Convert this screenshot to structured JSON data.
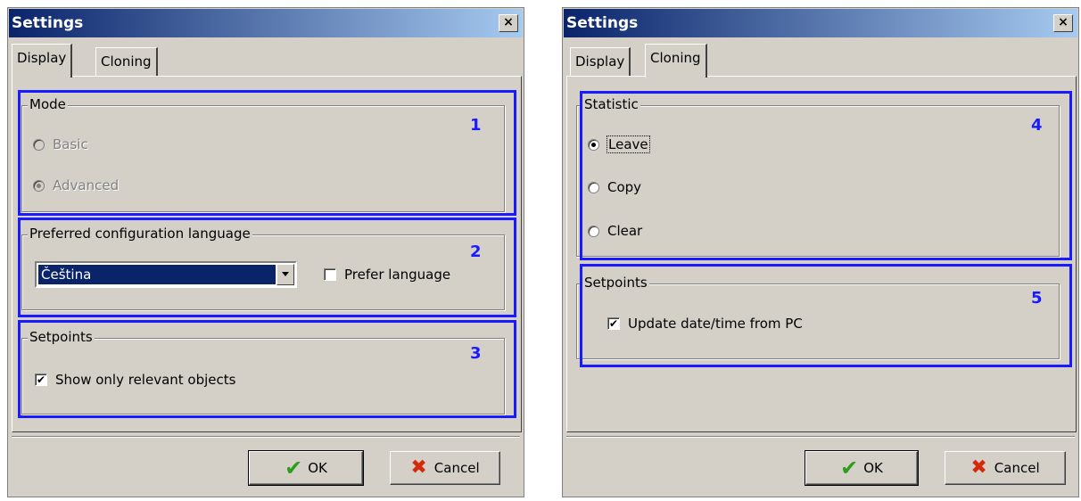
{
  "left_dialog": {
    "title": "Settings",
    "close": "×",
    "tabs": [
      "Display",
      "Cloning"
    ],
    "active_tab": "Display",
    "mode": {
      "title": "Mode",
      "options": [
        "Basic",
        "Advanced"
      ],
      "selected": "Advanced",
      "enabled": false,
      "marker": "1"
    },
    "language": {
      "title": "Preferred configuration language",
      "value": "Čeština",
      "prefer_label": "Prefer language",
      "prefer_checked": false,
      "marker": "2"
    },
    "setpoints": {
      "title": "Setpoints",
      "show_relevant_label": "Show only relevant objects",
      "show_relevant_checked": true,
      "marker": "3"
    },
    "ok_label": "OK",
    "cancel_label": "Cancel"
  },
  "right_dialog": {
    "title": "Settings",
    "close": "×",
    "tabs": [
      "Display",
      "Cloning"
    ],
    "active_tab": "Cloning",
    "statistic": {
      "title": "Statistic",
      "options": [
        "Leave",
        "Copy",
        "Clear"
      ],
      "selected": "Leave",
      "marker": "4"
    },
    "setpoints": {
      "title": "Setpoints",
      "update_label": "Update date/time from PC",
      "update_checked": true,
      "marker": "5"
    },
    "ok_label": "OK",
    "cancel_label": "Cancel"
  },
  "colors": {
    "highlight": "#1a1aff",
    "title_bar": "#0a246a",
    "ok_icon": "#2e9e1a",
    "cancel_icon": "#d42a0a"
  },
  "icons": {
    "ok": "checkmark-icon",
    "cancel": "cross-icon",
    "check": "✔"
  }
}
